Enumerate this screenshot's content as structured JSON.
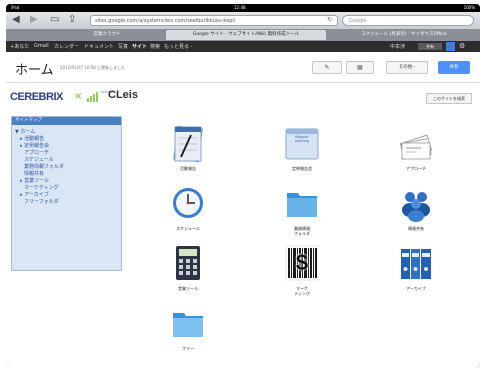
{
  "status": {
    "left": "iPad",
    "center": "12:48",
    "right": "100%"
  },
  "browser": {
    "back": "◀",
    "forward": "▶",
    "bookmarks": "▭",
    "share": "⇪",
    "url": "sites.google.com/a/systemcleis.com/seeiburikkusu-kopi/",
    "search_placeholder": "Google",
    "tabs": [
      {
        "label": "営業クラウド"
      },
      {
        "label": "Google サイト - ウェブサイト/Wiki 無料作成ツール"
      },
      {
        "label": "スケジュール (月表示) - サイボウズOffice"
      }
    ]
  },
  "gbar": {
    "items": [
      "+あなた",
      "Gmail",
      "カレンダー",
      "ドキュメント",
      "写真",
      "サイト",
      "検索",
      "もっと見る -"
    ],
    "user": "中本渉",
    "share_label": "共有",
    "gear": "⚙"
  },
  "header": {
    "title": "ホーム",
    "meta": "2012/01/07 10:56 に更新しました",
    "edit_icon": "✎",
    "page_icon": "▤",
    "more_label": "その他 -",
    "share_label": "共有"
  },
  "site": {
    "logo_main": "CEREBRIX",
    "logo_x": "×",
    "logo_sub": "SYSTEM",
    "logo_partner": "CLeis",
    "search_button": "このサイトを検索"
  },
  "sidebar": {
    "title": "サイトマップ",
    "items": [
      {
        "label": "▼ ホーム",
        "level": 0
      },
      {
        "label": "▸ 活動報告",
        "level": 1
      },
      {
        "label": "▸ 定例報告会",
        "level": 1
      },
      {
        "label": "アプローチ",
        "level": 1
      },
      {
        "label": "スケジュール",
        "level": 1
      },
      {
        "label": "業務情報フォルダ",
        "level": 1
      },
      {
        "label": "情報共有",
        "level": 1
      },
      {
        "label": "▸ 営業ツール",
        "level": 1
      },
      {
        "label": "マーケティング",
        "level": 1
      },
      {
        "label": "▸ アーカイブ",
        "level": 1
      },
      {
        "label": "フリーフォルダ",
        "level": 1
      }
    ]
  },
  "tiles": [
    {
      "name": "notepad",
      "label": "活動報告"
    },
    {
      "name": "regular",
      "label": "定例報告会",
      "icon_text": "Regular\nmeeting"
    },
    {
      "name": "cards",
      "label": "アプローチ"
    },
    {
      "name": "clock",
      "label": "スケジュール"
    },
    {
      "name": "folder",
      "label": "業務情報\nフォルダ"
    },
    {
      "name": "people",
      "label": "情報共有"
    },
    {
      "name": "calculator",
      "label": "営業ツール"
    },
    {
      "name": "barcode",
      "label": "マーケ\nティング",
      "icon_text": "$"
    },
    {
      "name": "binders",
      "label": "アーカイブ"
    },
    {
      "name": "free-folder",
      "label": "フリー"
    }
  ]
}
